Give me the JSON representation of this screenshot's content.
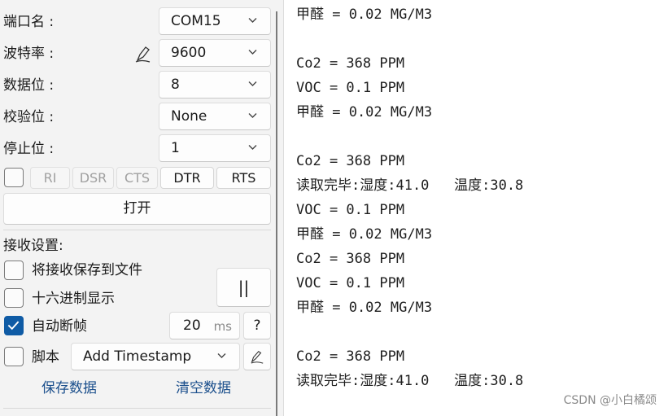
{
  "settings": {
    "port_label": "端口名 :",
    "port_value": "COM15",
    "baud_label": "波特率 :",
    "baud_value": "9600",
    "databits_label": "数据位 :",
    "databits_value": "8",
    "parity_label": "校验位 :",
    "parity_value": "None",
    "stopbits_label": "停止位 :",
    "stopbits_value": "1"
  },
  "signals": {
    "ri": "RI",
    "dsr": "DSR",
    "cts": "CTS",
    "dtr": "DTR",
    "rts": "RTS"
  },
  "open_button": "打开",
  "receive": {
    "header": "接收设置:",
    "save_to_file": "将接收保存到文件",
    "hex_display": "十六进制显示",
    "auto_frame": "自动断帧",
    "auto_frame_checked": true,
    "frame_value": "20",
    "frame_unit": "ms",
    "help": "?",
    "pause_symbol": "||",
    "script_label": "脚本",
    "script_value": "Add Timestamp"
  },
  "bottom": {
    "save_data": "保存数据",
    "clear_data": "清空数据"
  },
  "output": {
    "lines": [
      "甲醛 = 0.02 MG/M3",
      "",
      "Co2 = 368 PPM",
      "VOC = 0.1 PPM",
      "甲醛 = 0.02 MG/M3",
      "",
      "Co2 = 368 PPM",
      "读取完毕:湿度:41.0   温度:30.8",
      "VOC = 0.1 PPM",
      "甲醛 = 0.02 MG/M3",
      "Co2 = 368 PPM",
      "VOC = 0.1 PPM",
      "甲醛 = 0.02 MG/M3",
      "",
      "Co2 = 368 PPM",
      "读取完毕:湿度:41.0   温度:30.8"
    ]
  },
  "watermark": "CSDN @小白橘颂",
  "colors": {
    "accent": "#0f5ba5",
    "link": "#1b4f8c"
  }
}
